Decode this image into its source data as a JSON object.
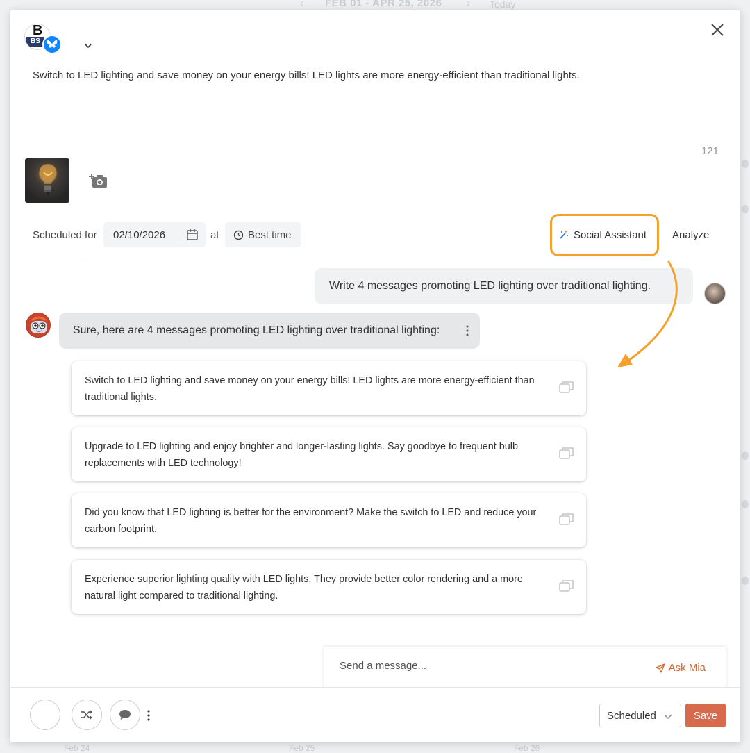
{
  "background": {
    "date_range": "FEB 01 - APR 25, 2026",
    "today_label": "Today",
    "bottom_days": [
      "Feb 24",
      "Feb 25",
      "Feb 26"
    ]
  },
  "composer": {
    "post_text": "Switch to LED lighting and save money on your energy bills! LED lights are more energy-efficient than traditional lights.",
    "char_count": "121",
    "scheduled_label": "Scheduled for",
    "date_value": "02/10/2026",
    "at_label": "at",
    "best_time_label": "Best time",
    "social_assistant_label": "Social Assistant",
    "analyze_label": "Analyze"
  },
  "chat": {
    "user_message": "Write 4 messages promoting LED lighting over traditional lighting.",
    "ai_reply": "Sure, here are 4 messages promoting LED lighting over traditional lighting:",
    "suggestions": [
      "Switch to LED lighting and save money on your energy bills! LED lights are more energy-efficient than traditional lights.",
      "Upgrade to LED lighting and enjoy brighter and longer-lasting lights. Say goodbye to frequent bulb replacements with LED technology!",
      "Did you know that LED lighting is better for the environment? Make the switch to LED and reduce your carbon footprint.",
      "Experience superior lighting quality with LED lights. They provide better color rendering and a more natural light compared to traditional lighting."
    ],
    "input_placeholder": "Send a message...",
    "ask_button": "Ask Mia"
  },
  "footer": {
    "status_value": "Scheduled",
    "save_label": "Save"
  },
  "colors": {
    "highlight": "#f5a02a",
    "accent": "#d7694c",
    "ask_mia": "#d7662c",
    "bluesky": "#1185fe"
  },
  "icons": [
    "chevron-down-icon",
    "close-icon",
    "add-photo-icon",
    "calendar-icon",
    "clock-icon",
    "magic-wand-icon",
    "more-vertical-icon",
    "copy-icon",
    "send-icon",
    "shuffle-icon",
    "comment-icon"
  ]
}
